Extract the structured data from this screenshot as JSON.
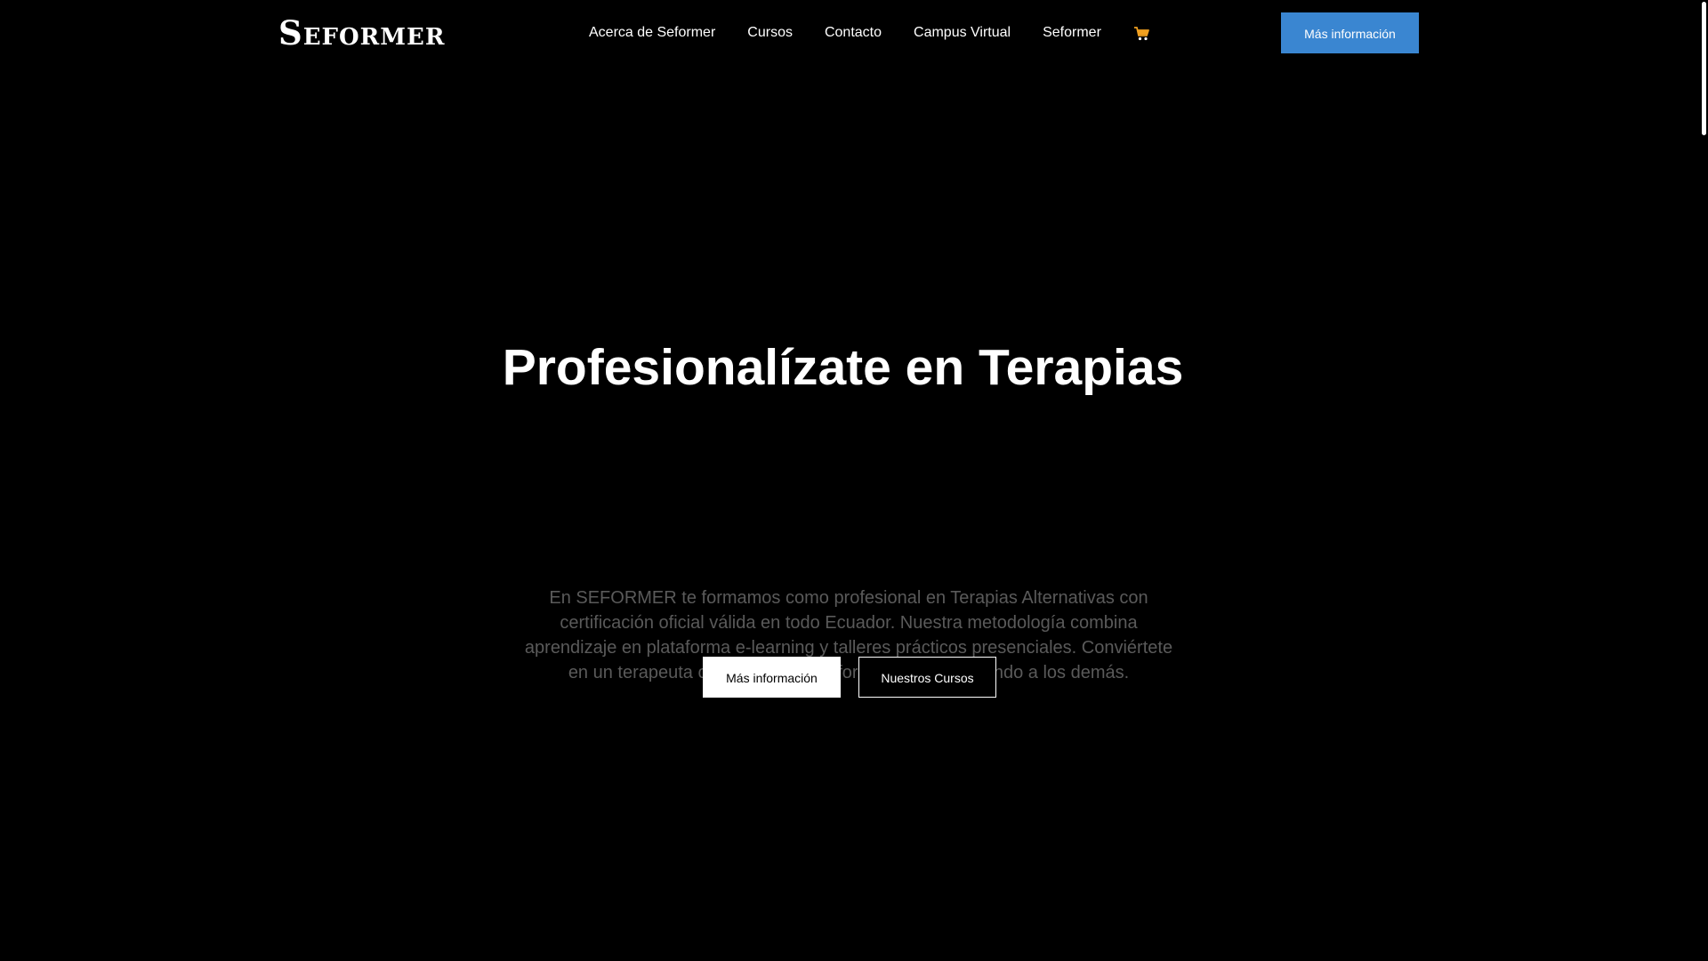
{
  "header": {
    "logo_text": "Seformer",
    "nav_items": [
      {
        "label": "Acerca de Seformer"
      },
      {
        "label": "Cursos"
      },
      {
        "label": "Contacto"
      },
      {
        "label": "Campus Virtual"
      },
      {
        "label": "Seformer"
      }
    ],
    "cart_icon": "shopping-cart-icon",
    "cta_label": "Más información"
  },
  "hero": {
    "title": "Profesionalízate en Terapias",
    "description": "En SEFORMER te formamos como profesional en Terapias Alternativas con certificación oficial válida en todo Ecuador. Nuestra metodología combina aprendizaje en plataforma e-learning y talleres prácticos presenciales. Conviértete en un terapeuta certificado y transforma tu vida ayudando a los demás.",
    "primary_button_label": "Más información",
    "secondary_button_label": "Nuestros Cursos"
  },
  "colors": {
    "background": "#000000",
    "accent": "#3a86d1",
    "text": "#ffffff",
    "muted_text": "#5a5a5a",
    "cart": "#f0a020"
  }
}
